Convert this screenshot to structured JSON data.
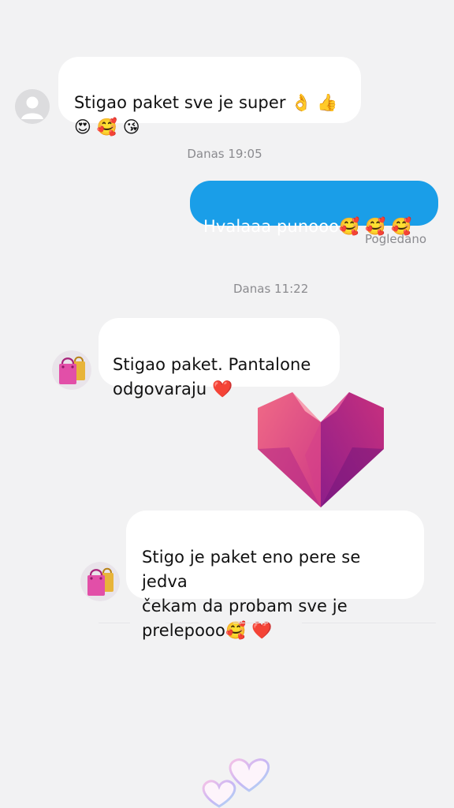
{
  "conversation": {
    "messages": [
      {
        "direction": "incoming",
        "text": "Stigao paket sve je super 👌 👍\n😍 🥰 😘"
      },
      {
        "direction": "timestamp",
        "text": "Danas 19:05"
      },
      {
        "direction": "outgoing",
        "text": "Hvalaaa punooo🥰 🥰 🥰"
      },
      {
        "direction": "status",
        "text": "Pogledano"
      },
      {
        "direction": "timestamp",
        "text": "Danas 11:22"
      },
      {
        "direction": "incoming",
        "text": "Stigao paket. Pantalone\nodgovaraju ❤️"
      },
      {
        "direction": "incoming",
        "text": "Stigo je paket eno pere se jedva\nčekam da probam sve je\nprelepooo🥰 ❤️"
      }
    ]
  },
  "colors": {
    "background": "#f2f2f3",
    "incoming_bubble": "#ffffff",
    "outgoing_bubble": "#1a9ee8",
    "meta_text": "#8b8b8f",
    "heart_sticker": "#c2277f"
  },
  "icons": {
    "avatar_1": "default-user-avatar-icon",
    "avatar_2": "shopping-bags-icon",
    "sticker": "geometric-heart-sticker",
    "floating": "floating-hearts-icon"
  }
}
